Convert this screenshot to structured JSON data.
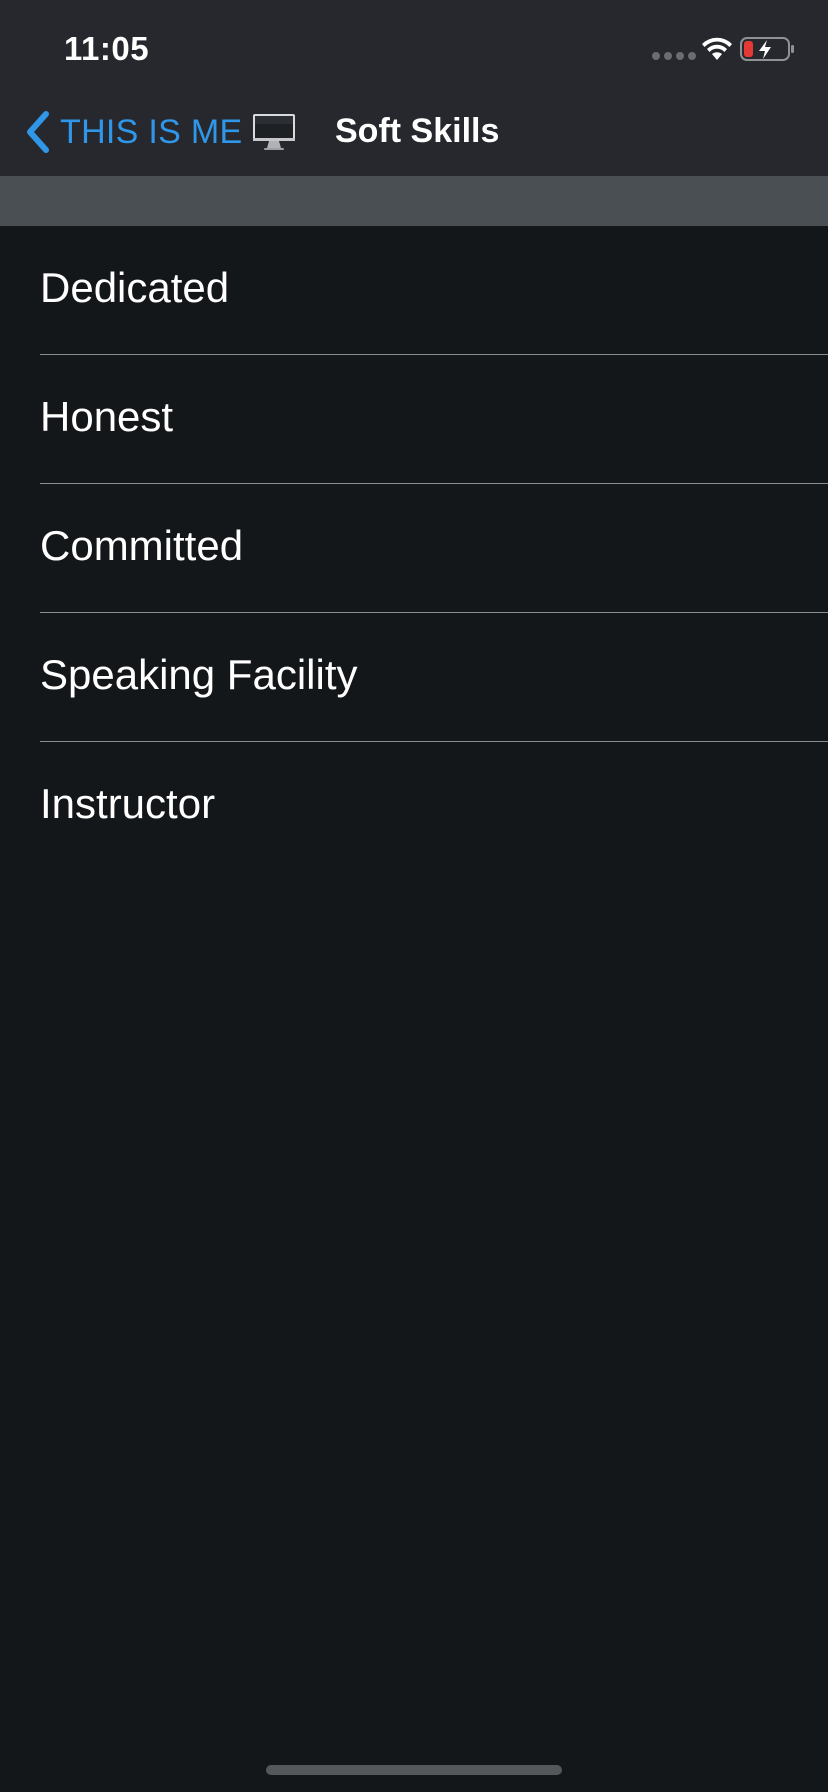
{
  "status_bar": {
    "time": "11:05",
    "battery_color": "#e53935"
  },
  "nav": {
    "back_label": "THIS IS ME",
    "title": "Soft Skills",
    "accent_color": "#2f96e8"
  },
  "list": {
    "items": [
      {
        "label": "Dedicated"
      },
      {
        "label": "Honest"
      },
      {
        "label": "Committed"
      },
      {
        "label": "Speaking Facility"
      },
      {
        "label": "Instructor"
      }
    ]
  },
  "icons": {
    "back": "chevron-left-icon",
    "computer": "desktop-computer-icon",
    "wifi": "wifi-icon",
    "battery": "battery-charging-icon"
  }
}
